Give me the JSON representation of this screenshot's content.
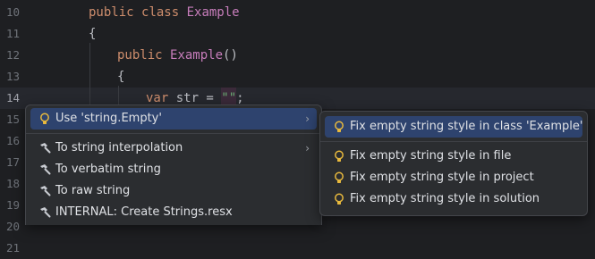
{
  "editor": {
    "lines": [
      {
        "num": "10",
        "indent": 0,
        "tokens": [
          {
            "t": "public ",
            "c": "kw"
          },
          {
            "t": "class ",
            "c": "kw"
          },
          {
            "t": "Example",
            "c": "cls"
          }
        ]
      },
      {
        "num": "11",
        "indent": 0,
        "tokens": [
          {
            "t": "{",
            "c": "plain"
          }
        ]
      },
      {
        "num": "12",
        "indent": 1,
        "tokens": [
          {
            "t": "public ",
            "c": "kw"
          },
          {
            "t": "Example",
            "c": "cls"
          },
          {
            "t": "()",
            "c": "plain"
          }
        ]
      },
      {
        "num": "13",
        "indent": 1,
        "tokens": [
          {
            "t": "{",
            "c": "plain"
          }
        ]
      },
      {
        "num": "14",
        "indent": 2,
        "current": true,
        "tokens": [
          {
            "t": "var ",
            "c": "kw"
          },
          {
            "t": "str = ",
            "c": "plain"
          },
          {
            "t": "\"\"",
            "c": "str"
          },
          {
            "t": ";",
            "c": "plain"
          }
        ]
      },
      {
        "num": "15",
        "indent": 0,
        "tokens": []
      },
      {
        "num": "16",
        "indent": 0,
        "tokens": []
      },
      {
        "num": "17",
        "indent": 0,
        "tokens": []
      },
      {
        "num": "18",
        "indent": 0,
        "tokens": []
      },
      {
        "num": "19",
        "indent": 0,
        "tokens": []
      },
      {
        "num": "20",
        "indent": 0,
        "tokens": []
      },
      {
        "num": "21",
        "indent": 0,
        "tokens": []
      }
    ]
  },
  "context_menu": {
    "items": [
      {
        "label": "Use 'string.Empty'",
        "icon": "bulb-icon",
        "submenu": true,
        "selected": true
      },
      {
        "separator": true
      },
      {
        "label": "To string interpolation",
        "icon": "hammer-icon",
        "submenu": true
      },
      {
        "label": "To verbatim string",
        "icon": "hammer-icon"
      },
      {
        "label": "To raw string",
        "icon": "hammer-icon"
      },
      {
        "label": "INTERNAL: Create Strings.resx",
        "icon": "hammer-icon"
      }
    ]
  },
  "submenu": {
    "items": [
      {
        "label": "Fix empty string style in class 'Example'",
        "icon": "bulb-icon",
        "selected": true
      },
      {
        "separator": true
      },
      {
        "label": "Fix empty string style in file",
        "icon": "bulb-icon"
      },
      {
        "label": "Fix empty string style in project",
        "icon": "bulb-icon"
      },
      {
        "label": "Fix empty string style in solution",
        "icon": "bulb-icon"
      }
    ]
  },
  "colors": {
    "background": "#1e1f22",
    "keyword": "#cf8e6d",
    "class_name": "#c77dbb",
    "selection": "#2e436e",
    "bulb": "#e8b93d"
  }
}
